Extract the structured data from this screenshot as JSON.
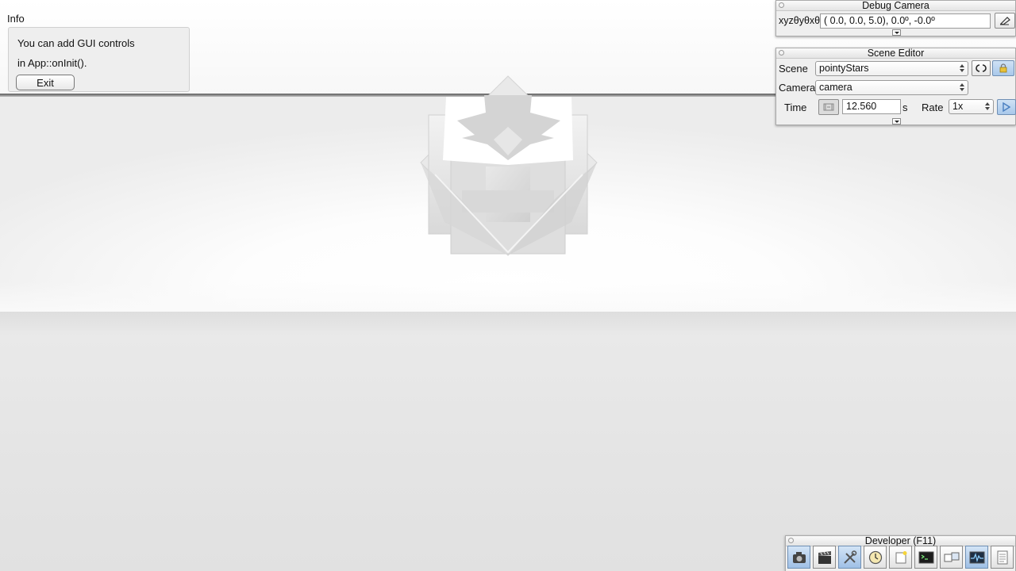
{
  "info": {
    "title": "Info",
    "line1": "You can add GUI controls",
    "line2": "in App::onInit().",
    "exit_label": "Exit"
  },
  "debug_camera": {
    "title": "Debug Camera",
    "label": "xyzθyθxθz",
    "value": "(  0.0,   0.0,   5.0),   0.0º,  -0.0º"
  },
  "scene_editor": {
    "title": "Scene Editor",
    "scene_label": "Scene",
    "scene_value": "pointyStars",
    "camera_label": "Camera",
    "camera_value": "camera",
    "time_label": "Time",
    "time_value": "12.560",
    "time_unit": "s",
    "rate_label": "Rate",
    "rate_value": "1x"
  },
  "developer": {
    "title": "Developer (F11)",
    "buttons": [
      "camera-icon",
      "clapperboard-icon",
      "tools-icon",
      "clock-icon",
      "note-icon",
      "console-icon",
      "windows-icon",
      "profiler-icon",
      "document-icon"
    ],
    "active_buttons": [
      "camera-icon",
      "tools-icon",
      "profiler-icon"
    ]
  },
  "colors": {
    "accent": "#a9c8ea",
    "panel": "#efefef"
  }
}
